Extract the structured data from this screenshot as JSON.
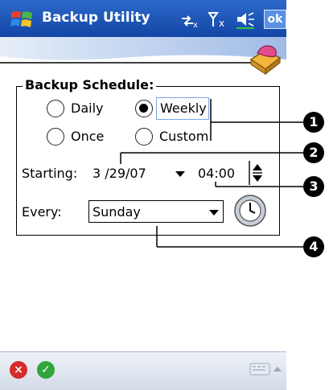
{
  "titlebar": {
    "title": "Backup Utility",
    "ok_label": "ok",
    "icons": [
      "windows-start-icon",
      "connectivity-icon",
      "signal-icon",
      "volume-icon"
    ]
  },
  "schedule": {
    "group_label": "Backup Schedule:",
    "options": [
      {
        "label": "Daily",
        "selected": false
      },
      {
        "label": "Weekly",
        "selected": true
      },
      {
        "label": "Once",
        "selected": false
      },
      {
        "label": "Custom",
        "selected": false
      }
    ],
    "starting_label": "Starting:",
    "start_date": "3 /29/07",
    "start_time": "04:00",
    "every_label": "Every:",
    "every_value": "Sunday"
  },
  "callouts": [
    "1",
    "2",
    "3",
    "4"
  ],
  "colors": {
    "titlebar": "#1f56b8",
    "accent": "#5a91e6",
    "cancel": "#d42b2b",
    "confirm": "#2fa53a"
  }
}
